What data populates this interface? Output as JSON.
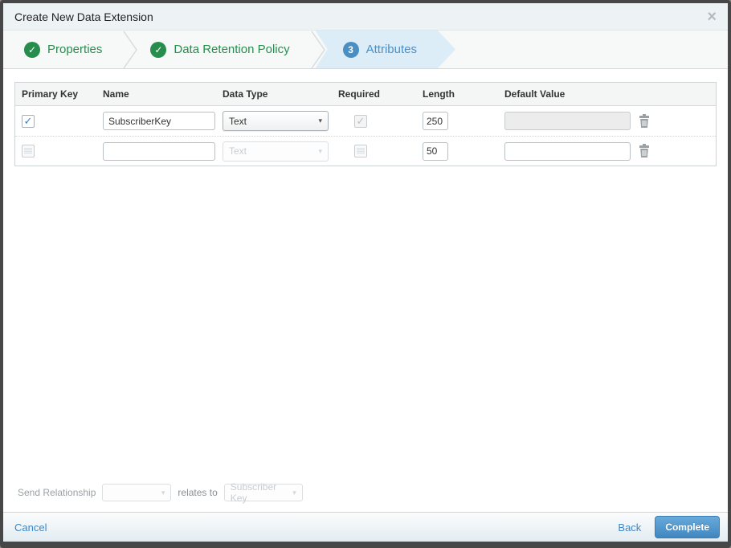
{
  "modal": {
    "title": "Create New Data Extension"
  },
  "icons": {
    "check": "✓",
    "close": "×",
    "caret": "▾"
  },
  "wizard": {
    "steps": [
      {
        "label": "Properties",
        "status": "complete"
      },
      {
        "label": "Data Retention Policy",
        "status": "complete"
      },
      {
        "label": "Attributes",
        "status": "active",
        "number": "3"
      }
    ]
  },
  "table": {
    "headers": [
      "Primary Key",
      "Name",
      "Data Type",
      "Required",
      "Length",
      "Default Value"
    ],
    "rows": [
      {
        "primary_key": true,
        "name": "SubscriberKey",
        "data_type": "Text",
        "required": true,
        "length": "250",
        "default_value": ""
      },
      {
        "primary_key": false,
        "name": "",
        "data_type": "Text",
        "required": false,
        "length": "50",
        "default_value": ""
      }
    ]
  },
  "send_relationship": {
    "label": "Send Relationship",
    "relates_to_label": "relates to",
    "relates_to_value": "Subscriber Key"
  },
  "footer": {
    "cancel_label": "Cancel",
    "back_label": "Back",
    "complete_label": "Complete"
  },
  "colors": {
    "step_complete_green": "#268d4d",
    "step_active_blue": "#4a90c6",
    "step_active_bg": "#ddedf7",
    "primary_button_blue": "#4186bf",
    "link_blue": "#3c87c7",
    "checkbox_check_blue": "#3a7fc1"
  }
}
